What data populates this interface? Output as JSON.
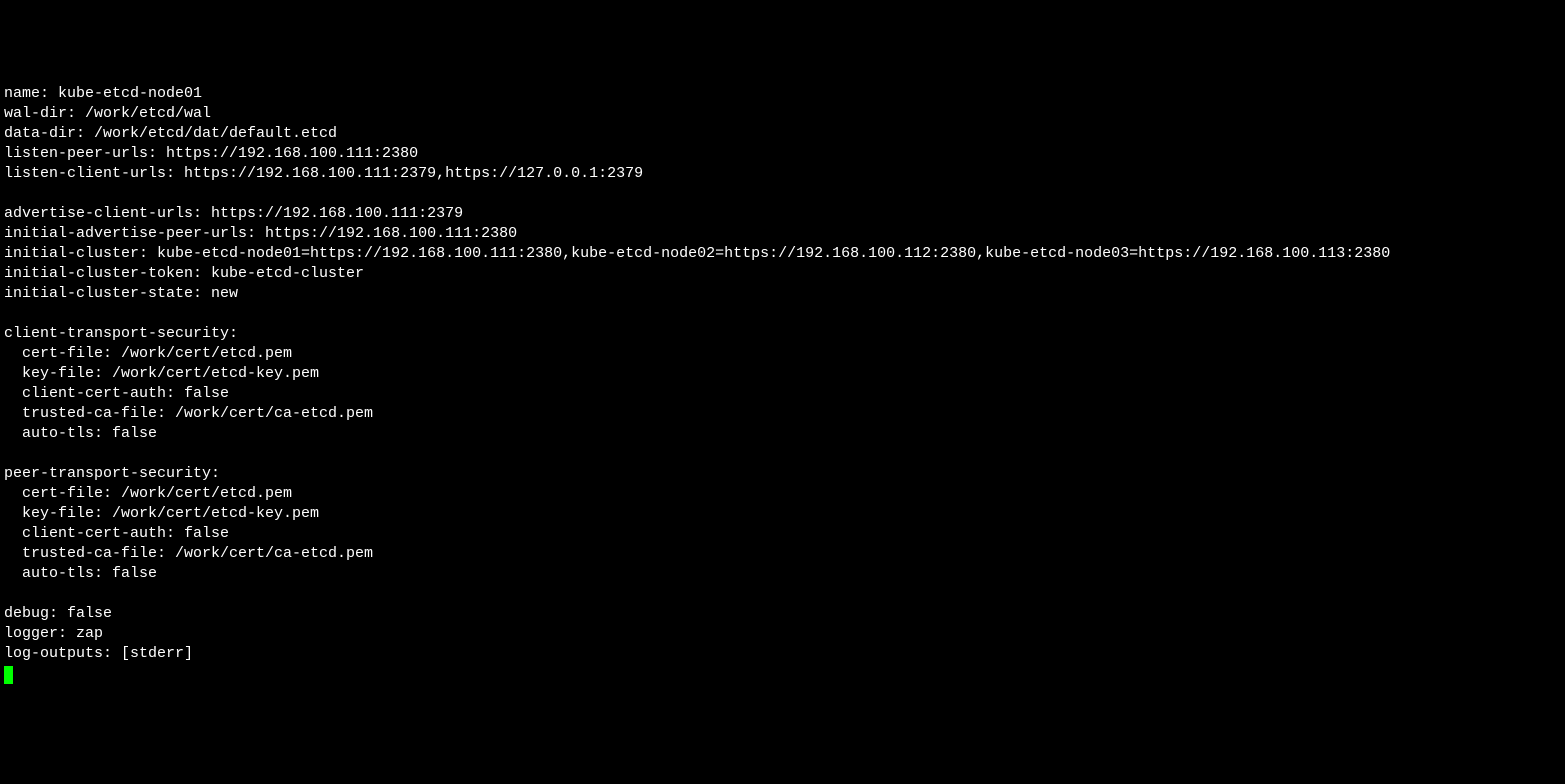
{
  "terminal": {
    "lines": [
      "name: kube-etcd-node01",
      "wal-dir: /work/etcd/wal",
      "data-dir: /work/etcd/dat/default.etcd",
      "listen-peer-urls: https://192.168.100.111:2380",
      "listen-client-urls: https://192.168.100.111:2379,https://127.0.0.1:2379",
      "",
      "advertise-client-urls: https://192.168.100.111:2379",
      "initial-advertise-peer-urls: https://192.168.100.111:2380",
      "initial-cluster: kube-etcd-node01=https://192.168.100.111:2380,kube-etcd-node02=https://192.168.100.112:2380,kube-etcd-node03=https://192.168.100.113:2380",
      "initial-cluster-token: kube-etcd-cluster",
      "initial-cluster-state: new",
      "",
      "client-transport-security:",
      "  cert-file: /work/cert/etcd.pem",
      "  key-file: /work/cert/etcd-key.pem",
      "  client-cert-auth: false",
      "  trusted-ca-file: /work/cert/ca-etcd.pem",
      "  auto-tls: false",
      "",
      "peer-transport-security:",
      "  cert-file: /work/cert/etcd.pem",
      "  key-file: /work/cert/etcd-key.pem",
      "  client-cert-auth: false",
      "  trusted-ca-file: /work/cert/ca-etcd.pem",
      "  auto-tls: false",
      "",
      "debug: false",
      "logger: zap",
      "log-outputs: [stderr]"
    ]
  }
}
